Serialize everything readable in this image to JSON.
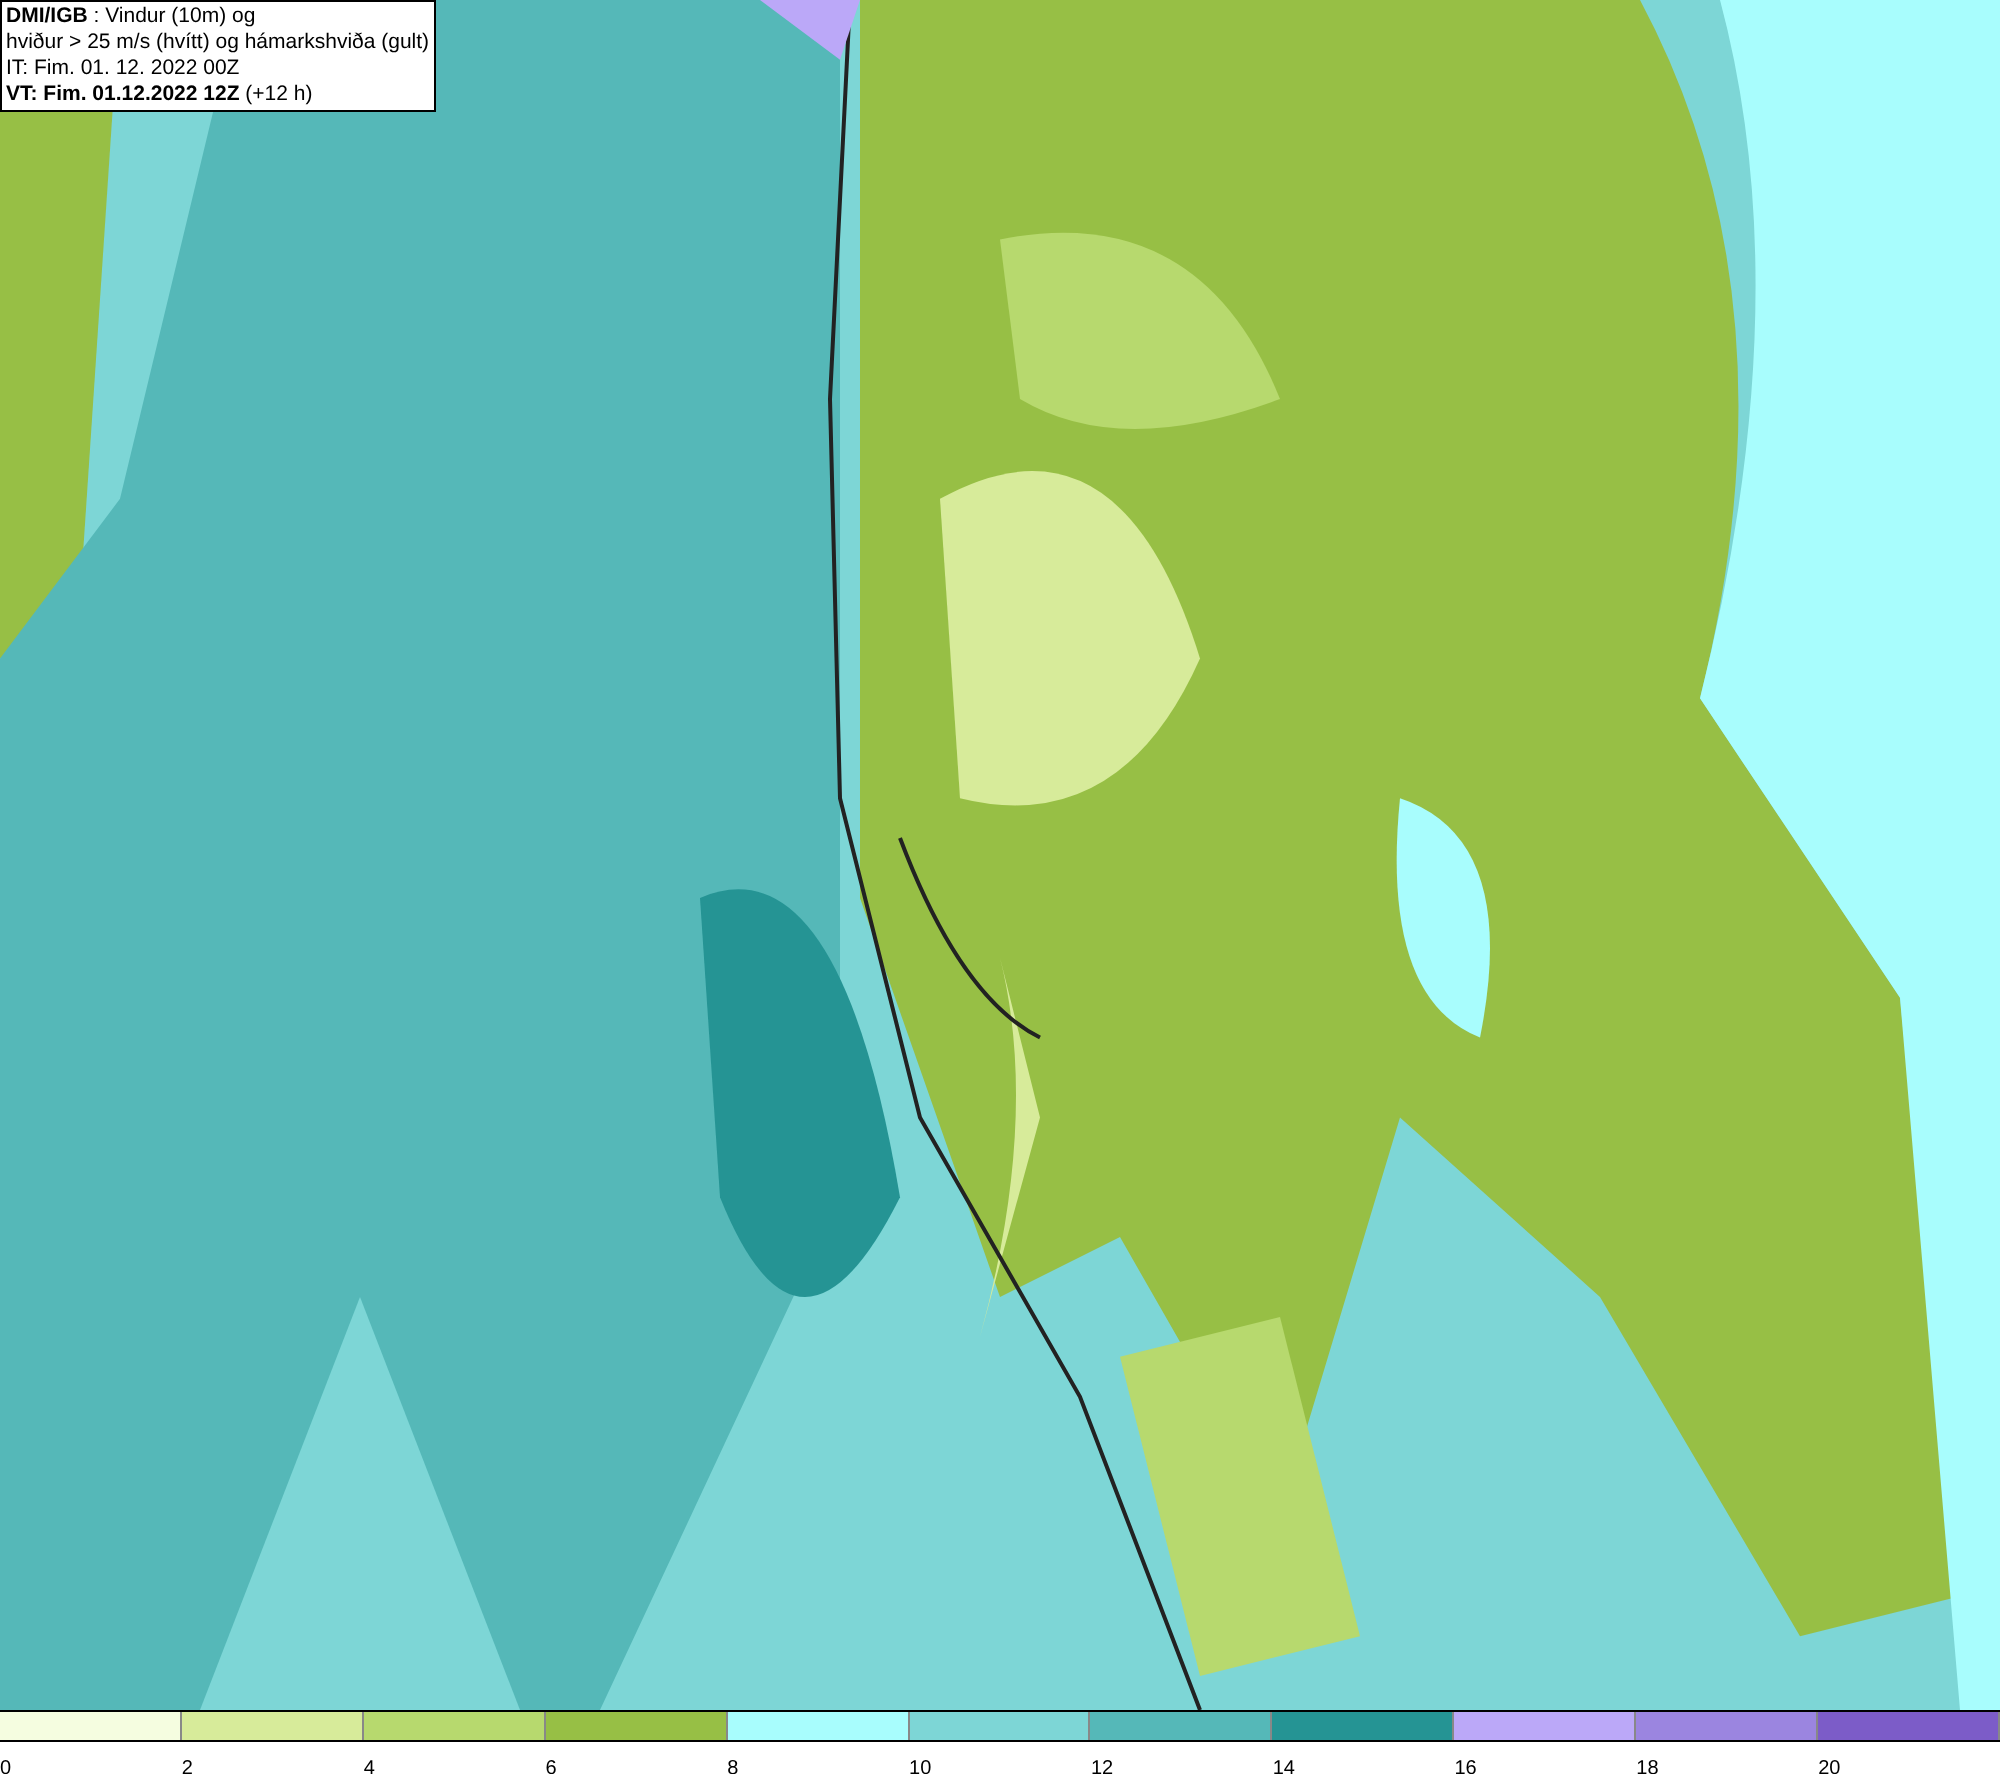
{
  "header": {
    "lines": [
      "**DMI/IGB** : Vindur (10m) og",
      "hviður > 25 m/s (hvítt) og hámarkshviða (gult)",
      "IT: Fim. 01. 12. 2022 00Z",
      "**VT: Fim. 01.12.2022 12Z** (+12 h)"
    ]
  },
  "legend": {
    "bins": [
      {
        "color": "#f5fde0",
        "label": "0"
      },
      {
        "color": "#d7eb9a",
        "label": "2"
      },
      {
        "color": "#b7d96e",
        "label": "4"
      },
      {
        "color": "#97bf45",
        "label": "6"
      },
      {
        "color": "#a8fdfd",
        "label": "8"
      },
      {
        "color": "#7dd6d6",
        "label": "10"
      },
      {
        "color": "#55b8b8",
        "label": "12"
      },
      {
        "color": "#259494",
        "label": "14"
      },
      {
        "color": "#bba8f8",
        "label": "16"
      },
      {
        "color": "#9b85e0",
        "label": "18"
      },
      {
        "color": "#7c5cc8",
        "label": "20"
      }
    ]
  }
}
